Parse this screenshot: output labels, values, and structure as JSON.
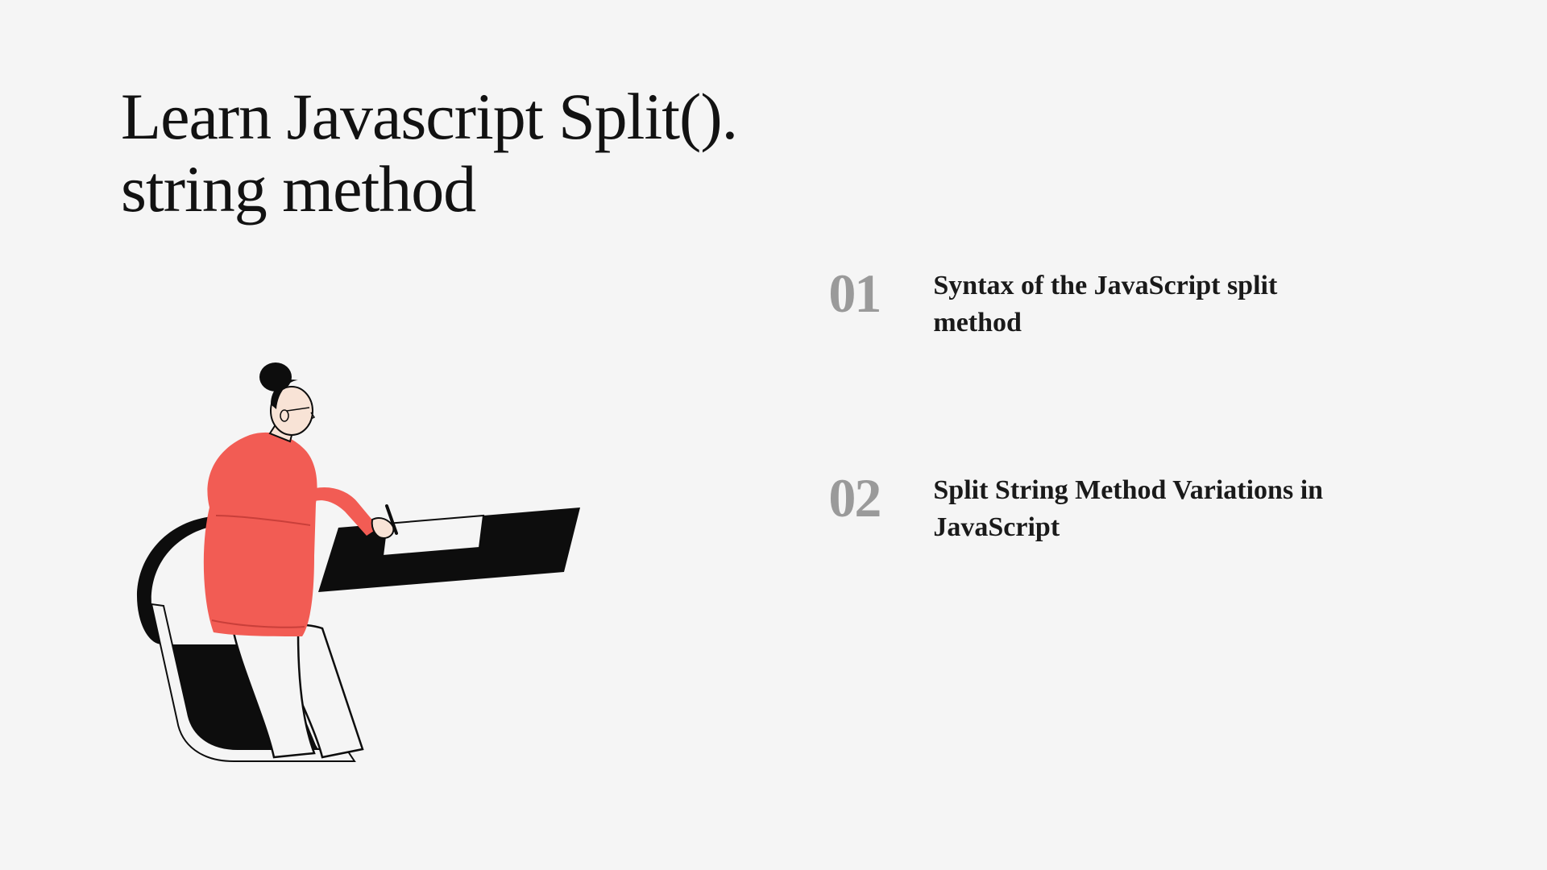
{
  "title": "Learn Javascript Split(). string method",
  "toc": [
    {
      "num": "01",
      "text": "Syntax of the JavaScript split method"
    },
    {
      "num": "02",
      "text": "Split String Method Variations in JavaScript"
    }
  ]
}
